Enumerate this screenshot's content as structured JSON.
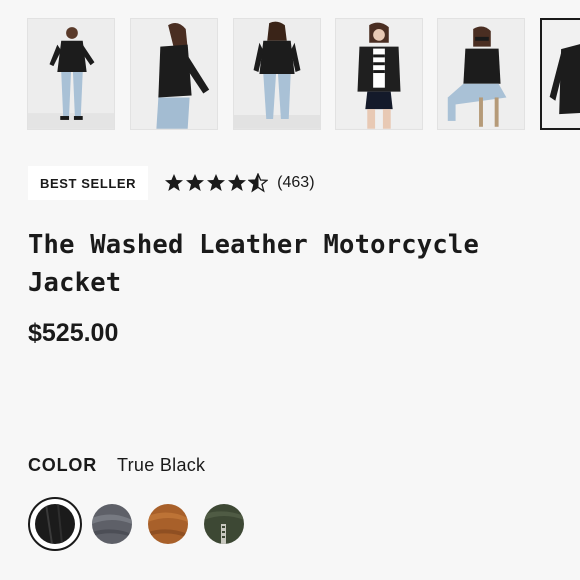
{
  "gallery": {
    "thumbnails": [
      {
        "name": "thumbnail-front-full",
        "selected": false
      },
      {
        "name": "thumbnail-side",
        "selected": false
      },
      {
        "name": "thumbnail-back",
        "selected": false
      },
      {
        "name": "thumbnail-front-shorts",
        "selected": false
      },
      {
        "name": "thumbnail-seated",
        "selected": false
      },
      {
        "name": "thumbnail-flat-lay",
        "selected": true
      }
    ]
  },
  "product": {
    "badge": "BEST SELLER",
    "rating": 4.5,
    "review_count": "(463)",
    "title": "The Washed Leather Motorcycle Jacket",
    "price": "$525.00"
  },
  "color": {
    "label": "COLOR",
    "selected_value": "True Black",
    "swatches": [
      {
        "name": "swatch-true-black",
        "hex": "#1b1b1b",
        "selected": true
      },
      {
        "name": "swatch-slate-grey",
        "hex": "#5e6068",
        "selected": false
      },
      {
        "name": "swatch-cognac",
        "hex": "#a8602a",
        "selected": false
      },
      {
        "name": "swatch-olive",
        "hex": "#3d4834",
        "selected": false
      }
    ]
  },
  "colors": {
    "text": "#1a1a1a",
    "background": "#f7f7f7",
    "badge_bg": "#ffffff",
    "star": "#1a1a1a"
  }
}
